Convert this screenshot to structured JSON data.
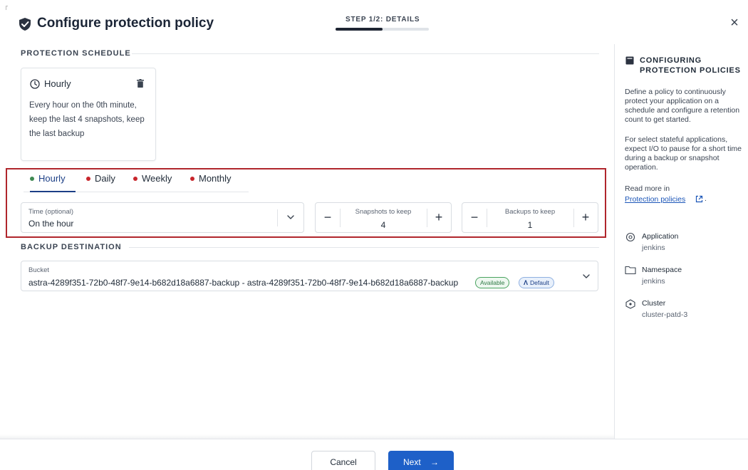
{
  "header": {
    "title": "Configure protection policy",
    "step_label": "STEP 1/2: DETAILS",
    "step_progress": 0.5,
    "close_label": "×"
  },
  "schedule_section": {
    "heading": "PROTECTION SCHEDULE",
    "card": {
      "title": "Hourly",
      "description": "Every hour on the 0th minute, keep the last 4 snapshots, keep the last backup"
    },
    "tabs": [
      {
        "label": "Hourly",
        "dot_color": "#3f8a52",
        "active": true
      },
      {
        "label": "Daily",
        "dot_color": "#c8262c",
        "active": false
      },
      {
        "label": "Weekly",
        "dot_color": "#c8262c",
        "active": false
      },
      {
        "label": "Monthly",
        "dot_color": "#c8262c",
        "active": false
      }
    ],
    "time_field": {
      "label": "Time (optional)",
      "value": "On the hour"
    },
    "snapshots_field": {
      "label": "Snapshots to keep",
      "value": "4",
      "minus": "−",
      "plus": "+"
    },
    "backups_field": {
      "label": "Backups to keep",
      "value": "1",
      "minus": "−",
      "plus": "+"
    }
  },
  "destination_section": {
    "heading": "BACKUP DESTINATION",
    "bucket_field": {
      "label": "Bucket",
      "value": "astra-4289f351-72b0-48f7-9e14-b682d18a6887-backup - astra-4289f351-72b0-48f7-9e14-b682d18a6887-backup",
      "badge_available": "Available",
      "badge_default_icon": "Λ",
      "badge_default": "Default"
    }
  },
  "sidebar": {
    "heading": "CONFIGURING PROTECTION POLICIES",
    "para1": "Define a policy to continuously protect your application on a schedule and configure a retention count to get started.",
    "para2": "For select stateful applications, expect I/O to pause for a short time during a backup or snapshot operation.",
    "read_more": "Read more in",
    "link": "Protection policies",
    "link_suffix": ".",
    "items": [
      {
        "label": "Application",
        "value": "jenkins",
        "icon": "application-icon"
      },
      {
        "label": "Namespace",
        "value": "jenkins",
        "icon": "folder-icon"
      },
      {
        "label": "Cluster",
        "value": "cluster-patd-3",
        "icon": "cluster-icon"
      }
    ]
  },
  "footer": {
    "cancel_label": "Cancel",
    "next_label": "Next",
    "next_arrow": "→"
  },
  "colors": {
    "primary": "#1e60c8",
    "highlight_border": "#b0262c",
    "active_tab": "#1c3f86"
  }
}
